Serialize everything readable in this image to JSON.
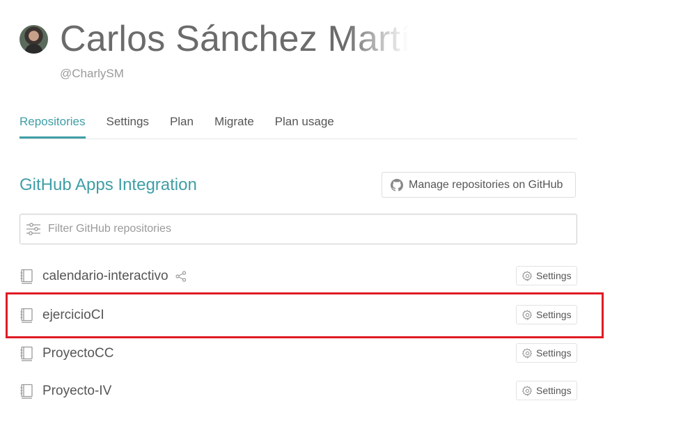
{
  "profile": {
    "name": "Carlos Sánchez Martín",
    "handle": "@CharlySM"
  },
  "tabs": [
    {
      "label": "Repositories",
      "active": true
    },
    {
      "label": "Settings",
      "active": false
    },
    {
      "label": "Plan",
      "active": false
    },
    {
      "label": "Migrate",
      "active": false
    },
    {
      "label": "Plan usage",
      "active": false
    }
  ],
  "section": {
    "title": "GitHub Apps Integration",
    "manage_button": "Manage repositories on GitHub"
  },
  "filter": {
    "placeholder": "Filter GitHub repositories",
    "value": ""
  },
  "repos": [
    {
      "name": "calendario-interactivo",
      "shared": true,
      "settings_label": "Settings"
    },
    {
      "name": "ejercicioCI",
      "shared": false,
      "settings_label": "Settings"
    },
    {
      "name": "ProyectoCC",
      "shared": false,
      "settings_label": "Settings"
    },
    {
      "name": "Proyecto-IV",
      "shared": false,
      "settings_label": "Settings"
    }
  ],
  "colors": {
    "accent": "#3f9ea6",
    "highlight": "#e01b24",
    "text": "#555555"
  },
  "icons": {
    "avatar": "avatar",
    "manage": "github-icon",
    "filter": "filter-sliders-icon",
    "repo": "repo-book-icon",
    "share": "share-icon",
    "settings": "gear-icon"
  }
}
